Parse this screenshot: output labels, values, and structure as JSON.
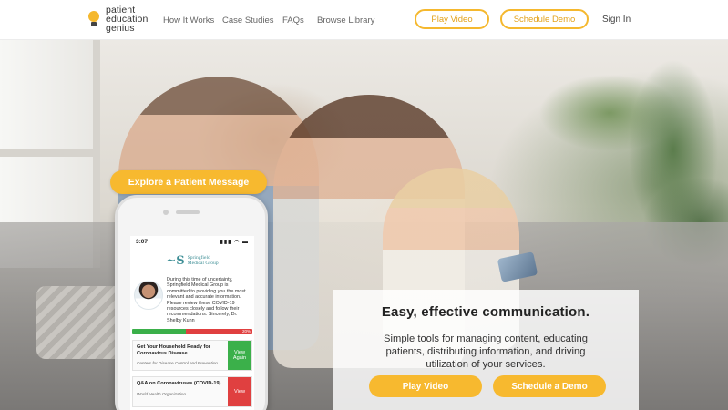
{
  "brand": {
    "logo_lines": [
      "patient",
      "education",
      "genius"
    ]
  },
  "nav": {
    "links": [
      "How It Works",
      "Case Studies",
      "FAQs",
      "Browse Library"
    ],
    "play_video": "Play Video",
    "schedule_demo": "Schedule Demo",
    "sign_in": "Sign In"
  },
  "hero": {
    "explore_label": "Explore a Patient Message"
  },
  "phone": {
    "time": "3:07",
    "status_icons": "▮▮▮ ◠ ▬",
    "org_mark": "~S",
    "org_name_lines": [
      "Springfield",
      "Medical Group"
    ],
    "message": "During this time of uncertainty, Springfield Medical Group is committed to providing you the most relevant and accurate information. Please review these COVID-19 resources closely and follow their recommendations. Sincerely, Dr. Shelby Kuhn",
    "progress_fraction": 0.45,
    "progress_label": "20%",
    "cards": [
      {
        "title": "Get Your Household Ready for Coronavirus Disease",
        "source": "Centers for Disease Control and Prevention",
        "action": "View Again",
        "status_color": "#3bb04a"
      },
      {
        "title": "Q&A on Coronaviruses (COVID-19)",
        "source": "World Health Organization",
        "action": "View",
        "status_color": "#e04040"
      }
    ]
  },
  "cta": {
    "heading": "Easy, effective communication.",
    "body": "Simple tools for managing content, educating patients, distributing information, and driving utilization of your services.",
    "play_video": "Play Video",
    "schedule_demo": "Schedule a Demo"
  },
  "colors": {
    "accent": "#f7b92f",
    "accent_text": "#e3a21a",
    "success": "#3bb04a",
    "danger": "#e04040",
    "brand_teal": "#3f8f96"
  }
}
